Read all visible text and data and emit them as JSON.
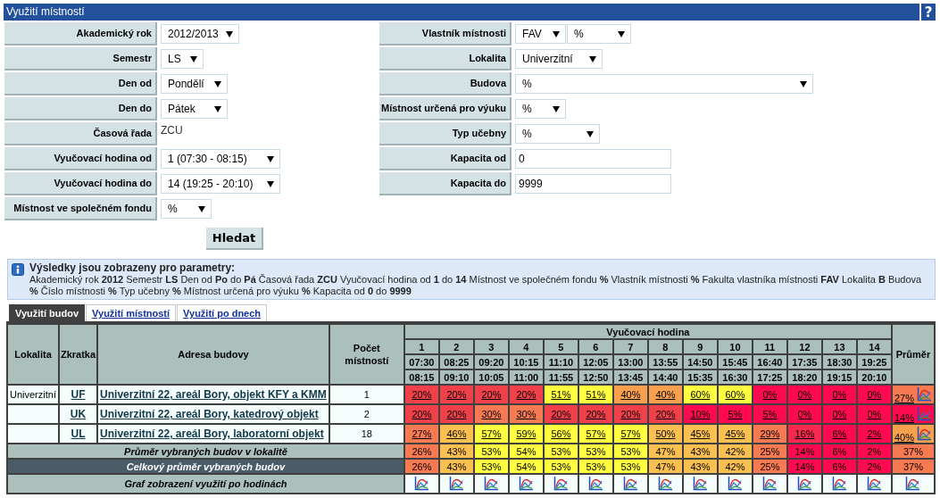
{
  "window": {
    "title": "Využití místností",
    "help": "?"
  },
  "filters_left": [
    {
      "label": "Akademický rok",
      "controls": [
        {
          "kind": "select",
          "value": "2012/2013"
        }
      ]
    },
    {
      "label": "Semestr",
      "controls": [
        {
          "kind": "select",
          "value": "LS"
        }
      ]
    },
    {
      "label": "Den od",
      "controls": [
        {
          "kind": "select",
          "value": "Pondělí"
        }
      ]
    },
    {
      "label": "Den do",
      "controls": [
        {
          "kind": "select",
          "value": "Pátek"
        }
      ]
    },
    {
      "label": "Časová řada",
      "controls": [
        {
          "kind": "text",
          "value": "ZCU"
        }
      ]
    },
    {
      "label": "Vyučovací hodina od",
      "controls": [
        {
          "kind": "select",
          "value": "1 (07:30 - 08:15)"
        }
      ]
    },
    {
      "label": "Vyučovací hodina do",
      "controls": [
        {
          "kind": "select",
          "value": "14 (19:25 - 20:10)"
        }
      ]
    },
    {
      "label": "Místnost ve společném fondu",
      "controls": [
        {
          "kind": "select",
          "value": "%"
        }
      ]
    }
  ],
  "filters_right": [
    {
      "label": "Vlastník místnosti",
      "controls": [
        {
          "kind": "select",
          "value": "FAV"
        },
        {
          "kind": "select",
          "value": "%"
        }
      ]
    },
    {
      "label": "Lokalita",
      "controls": [
        {
          "kind": "select",
          "value": "Univerzitní"
        }
      ]
    },
    {
      "label": "Budova",
      "controls": [
        {
          "kind": "select",
          "value": "%"
        }
      ]
    },
    {
      "label": "Místnost určená pro výuku",
      "controls": [
        {
          "kind": "select",
          "value": "%"
        }
      ]
    },
    {
      "label": "Typ učebny",
      "controls": [
        {
          "kind": "select",
          "value": "%"
        }
      ]
    },
    {
      "label": "Kapacita od",
      "controls": [
        {
          "kind": "input",
          "value": "0"
        }
      ]
    },
    {
      "label": "Kapacita do",
      "controls": [
        {
          "kind": "input",
          "value": "9999"
        }
      ]
    }
  ],
  "search_button": "Hledat",
  "info": {
    "title": "Výsledky jsou zobrazeny pro parametry:",
    "text": "Akademický rok **2012** Semestr **LS** Den od **Po** do **Pá** Časová řada **ZCU** Vyučovací hodina od **1** do **14** Místnost ve společném fondu **%** Vlastník místnosti **%** Fakulta vlastníka místnosti **FAV** Lokalita **B** Budova **%** Číslo místnosti **%** Typ učebny **%** Místnost určená pro výuku **%** Kapacita od **0** do **9999**"
  },
  "tabs": [
    {
      "label": "Využití budov",
      "selected": true
    },
    {
      "label": "Využití místností",
      "selected": false
    },
    {
      "label": "Využití po dnech",
      "selected": false
    }
  ],
  "table": {
    "columns": [
      "Lokalita",
      "Zkratka",
      "Adresa budovy",
      "Počet místností"
    ],
    "hour_group": "Vyučovací hodina",
    "average_column": "Průměr",
    "hours": [
      {
        "number": "1",
        "from": "07:30",
        "to": "08:15"
      },
      {
        "number": "2",
        "from": "08:25",
        "to": "09:10"
      },
      {
        "number": "3",
        "from": "09:20",
        "to": "10:05"
      },
      {
        "number": "4",
        "from": "10:15",
        "to": "11:00"
      },
      {
        "number": "5",
        "from": "11:10",
        "to": "11:55"
      },
      {
        "number": "6",
        "from": "12:05",
        "to": "12:50"
      },
      {
        "number": "7",
        "from": "13:00",
        "to": "13:45"
      },
      {
        "number": "8",
        "from": "13:55",
        "to": "14:40"
      },
      {
        "number": "9",
        "from": "14:50",
        "to": "15:35"
      },
      {
        "number": "10",
        "from": "15:45",
        "to": "16:30"
      },
      {
        "number": "11",
        "from": "16:40",
        "to": "17:25"
      },
      {
        "number": "12",
        "from": "17:35",
        "to": "18:20"
      },
      {
        "number": "13",
        "from": "18:30",
        "to": "19:15"
      },
      {
        "number": "14",
        "from": "19:25",
        "to": "20:10"
      }
    ],
    "rows": [
      {
        "lokalita": "Univerzitní",
        "code": "UF",
        "address": "Univerzitní 22, areál Bory, objekt KFY a KMM",
        "rooms": "1",
        "cells": [
          {
            "text": "20%",
            "color": "#f0404a"
          },
          {
            "text": "20%",
            "color": "#f0404a"
          },
          {
            "text": "20%",
            "color": "#f0404a"
          },
          {
            "text": "20%",
            "color": "#f0404a"
          },
          {
            "text": "51%",
            "color": "#ffff40"
          },
          {
            "text": "51%",
            "color": "#ffff40"
          },
          {
            "text": "40%",
            "color": "#f9a04e"
          },
          {
            "text": "40%",
            "color": "#f9a04e"
          },
          {
            "text": "60%",
            "color": "#ffff40"
          },
          {
            "text": "60%",
            "color": "#ffff40"
          },
          {
            "text": "0%",
            "color": "#ff0a50"
          },
          {
            "text": "0%",
            "color": "#ff0a50"
          },
          {
            "text": "0%",
            "color": "#ff0a50"
          },
          {
            "text": "0%",
            "color": "#ff0a50"
          }
        ],
        "average": {
          "text": "27%",
          "color": "#f87a52"
        }
      },
      {
        "code": "UK",
        "address": "Univerzitní 22, areál Bory, katedrový objekt",
        "rooms": "2",
        "cells": [
          {
            "text": "20%",
            "color": "#f0404a"
          },
          {
            "text": "20%",
            "color": "#f0404a"
          },
          {
            "text": "30%",
            "color": "#f87a52"
          },
          {
            "text": "30%",
            "color": "#f87a52"
          },
          {
            "text": "20%",
            "color": "#f0404a"
          },
          {
            "text": "20%",
            "color": "#f0404a"
          },
          {
            "text": "20%",
            "color": "#f0404a"
          },
          {
            "text": "20%",
            "color": "#f0404a"
          },
          {
            "text": "10%",
            "color": "#ff0a50"
          },
          {
            "text": "5%",
            "color": "#ff0a50"
          },
          {
            "text": "5%",
            "color": "#ff0a50"
          },
          {
            "text": "0%",
            "color": "#ff0a50"
          },
          {
            "text": "0%",
            "color": "#ff0a50"
          },
          {
            "text": "0%",
            "color": "#ff0a50"
          }
        ],
        "average": {
          "text": "14%",
          "color": "#ff0a50"
        }
      },
      {
        "code": "UL",
        "address": "Univerzitní 22, areál Bory, laboratorní objekt",
        "rooms": "18",
        "cells": [
          {
            "text": "27%",
            "color": "#f87a52"
          },
          {
            "text": "46%",
            "color": "#fcc050"
          },
          {
            "text": "57%",
            "color": "#ffff40"
          },
          {
            "text": "59%",
            "color": "#ffff40"
          },
          {
            "text": "56%",
            "color": "#ffff40"
          },
          {
            "text": "57%",
            "color": "#ffff40"
          },
          {
            "text": "57%",
            "color": "#ffff40"
          },
          {
            "text": "50%",
            "color": "#fcc050"
          },
          {
            "text": "45%",
            "color": "#fcc050"
          },
          {
            "text": "45%",
            "color": "#fcc050"
          },
          {
            "text": "29%",
            "color": "#f87a52"
          },
          {
            "text": "16%",
            "color": "#f8284e"
          },
          {
            "text": "6%",
            "color": "#ff0a50"
          },
          {
            "text": "2%",
            "color": "#ff0a50"
          }
        ],
        "average": {
          "text": "40%",
          "color": "#f9a04e"
        }
      }
    ],
    "summary_rows": [
      {
        "kind": "local",
        "label": "Průměr vybraných budov v lokalitě",
        "cells": [
          {
            "text": "26%",
            "color": "#f87a52"
          },
          {
            "text": "43%",
            "color": "#fcc050"
          },
          {
            "text": "53%",
            "color": "#ffff40"
          },
          {
            "text": "54%",
            "color": "#ffff40"
          },
          {
            "text": "53%",
            "color": "#ffff40"
          },
          {
            "text": "53%",
            "color": "#ffff40"
          },
          {
            "text": "53%",
            "color": "#ffff40"
          },
          {
            "text": "47%",
            "color": "#fcc050"
          },
          {
            "text": "43%",
            "color": "#fcc050"
          },
          {
            "text": "42%",
            "color": "#fcc050"
          },
          {
            "text": "25%",
            "color": "#f87a52"
          },
          {
            "text": "14%",
            "color": "#ff0a50"
          },
          {
            "text": "6%",
            "color": "#ff0a50"
          },
          {
            "text": "2%",
            "color": "#ff0a50"
          }
        ],
        "average": {
          "text": "37%",
          "color": "#f87a52"
        }
      },
      {
        "kind": "total",
        "label": "Celkový průměr vybraných budov",
        "cells": [
          {
            "text": "26%",
            "color": "#f87a52"
          },
          {
            "text": "43%",
            "color": "#fcc050"
          },
          {
            "text": "53%",
            "color": "#ffff40"
          },
          {
            "text": "54%",
            "color": "#ffff40"
          },
          {
            "text": "53%",
            "color": "#ffff40"
          },
          {
            "text": "53%",
            "color": "#ffff40"
          },
          {
            "text": "53%",
            "color": "#ffff40"
          },
          {
            "text": "47%",
            "color": "#fcc050"
          },
          {
            "text": "43%",
            "color": "#fcc050"
          },
          {
            "text": "42%",
            "color": "#fcc050"
          },
          {
            "text": "25%",
            "color": "#f87a52"
          },
          {
            "text": "14%",
            "color": "#ff0a50"
          },
          {
            "text": "6%",
            "color": "#ff0a50"
          },
          {
            "text": "2%",
            "color": "#ff0a50"
          }
        ],
        "average": {
          "text": "37%",
          "color": "#f87a52"
        }
      }
    ],
    "graph_row": {
      "label": "Graf zobrazení využití po hodinách"
    }
  }
}
